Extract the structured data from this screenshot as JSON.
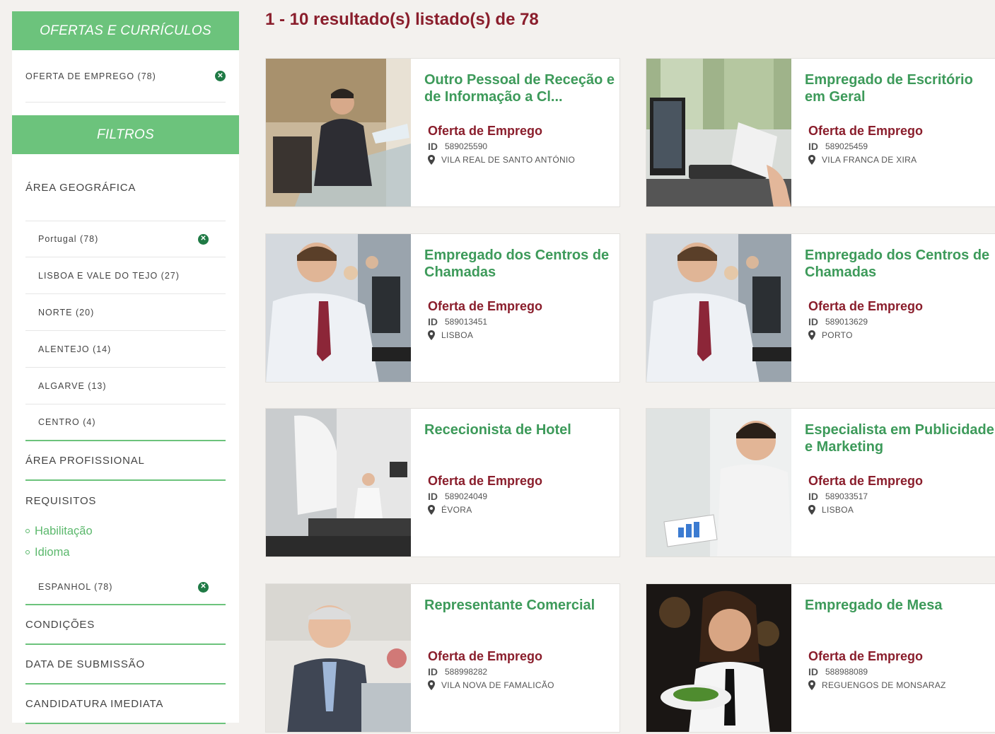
{
  "sidebar": {
    "header_offers": "OFERTAS E CURRÍCULOS",
    "offer_row": "OFERTA DE EMPREGO (78)",
    "header_filters": "FILTROS",
    "geo_title": "ÁREA GEOGRÁFICA",
    "geo_items": [
      "Portugal (78)",
      "LISBOA E VALE DO TEJO (27)",
      "NORTE (20)",
      "ALENTEJO (14)",
      "ALGARVE (13)",
      "CENTRO (4)"
    ],
    "area_prof": "ÁREA PROFISSIONAL",
    "requisitos": "REQUISITOS",
    "req_links": [
      "Habilitação",
      "Idioma"
    ],
    "espanhol": "ESPANHOL (78)",
    "condicoes": "CONDIÇÕES",
    "data_submissao": "DATA DE SUBMISSÃO",
    "candidatura": "CANDIDATURA IMEDIATA"
  },
  "results_header": "1 - 10 resultado(s) listado(s) de 78",
  "id_label": "ID",
  "cards": [
    {
      "title": "Outro Pessoal de Receção e de Informação a Cl...",
      "type": "Oferta de Emprego",
      "id": "589025590",
      "location": "VILA REAL DE SANTO ANTÓNIO"
    },
    {
      "title": "Empregado de Escritório em Geral",
      "type": "Oferta de Emprego",
      "id": "589025459",
      "location": "VILA FRANCA DE XIRA"
    },
    {
      "title": "Empregado dos Centros de Chamadas",
      "type": "Oferta de Emprego",
      "id": "589013451",
      "location": "LISBOA"
    },
    {
      "title": "Empregado dos Centros de Chamadas",
      "type": "Oferta de Emprego",
      "id": "589013629",
      "location": "PORTO"
    },
    {
      "title": "Rececionista de Hotel",
      "type": "Oferta de Emprego",
      "id": "589024049",
      "location": "ÉVORA"
    },
    {
      "title": "Especialista em Publicidade e Marketing",
      "type": "Oferta de Emprego",
      "id": "589033517",
      "location": "LISBOA"
    },
    {
      "title": "Representante Comercial",
      "type": "Oferta de Emprego",
      "id": "588998282",
      "location": "VILA NOVA DE FAMALICÃO"
    },
    {
      "title": "Empregado de Mesa",
      "type": "Oferta de Emprego",
      "id": "588988089",
      "location": "REGUENGOS DE MONSARAZ"
    }
  ],
  "colors": {
    "green": "#6cc37c",
    "maroon": "#8a1e2c",
    "title_green": "#3d9a5a"
  }
}
